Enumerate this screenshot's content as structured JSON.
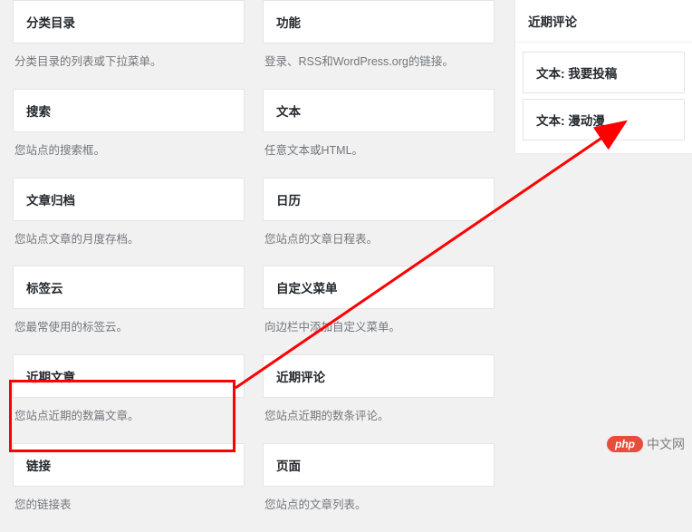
{
  "left_col": [
    {
      "title": "分类目录",
      "desc": "分类目录的列表或下拉菜单。"
    },
    {
      "title": "搜索",
      "desc": "您站点的搜索框。"
    },
    {
      "title": "文章归档",
      "desc": "您站点文章的月度存档。"
    },
    {
      "title": "标签云",
      "desc": "您最常使用的标签云。"
    },
    {
      "title": "近期文章",
      "desc": "您站点近期的数篇文章。"
    },
    {
      "title": "链接",
      "desc": "您的链接表"
    }
  ],
  "right_col": [
    {
      "title": "功能",
      "desc": "登录、RSS和WordPress.org的链接。"
    },
    {
      "title": "文本",
      "desc": "任意文本或HTML。"
    },
    {
      "title": "日历",
      "desc": "您站点的文章日程表。"
    },
    {
      "title": "自定义菜单",
      "desc": "向边栏中添加自定义菜单。"
    },
    {
      "title": "近期评论",
      "desc": "您站点近期的数条评论。"
    },
    {
      "title": "页面",
      "desc": "您站点的文章列表。"
    }
  ],
  "sidebar": {
    "header": "近期评论",
    "items": [
      "文本: 我要投稿",
      "文本: 漫动漫"
    ]
  },
  "watermark": {
    "badge": "php",
    "text": "中文网"
  }
}
